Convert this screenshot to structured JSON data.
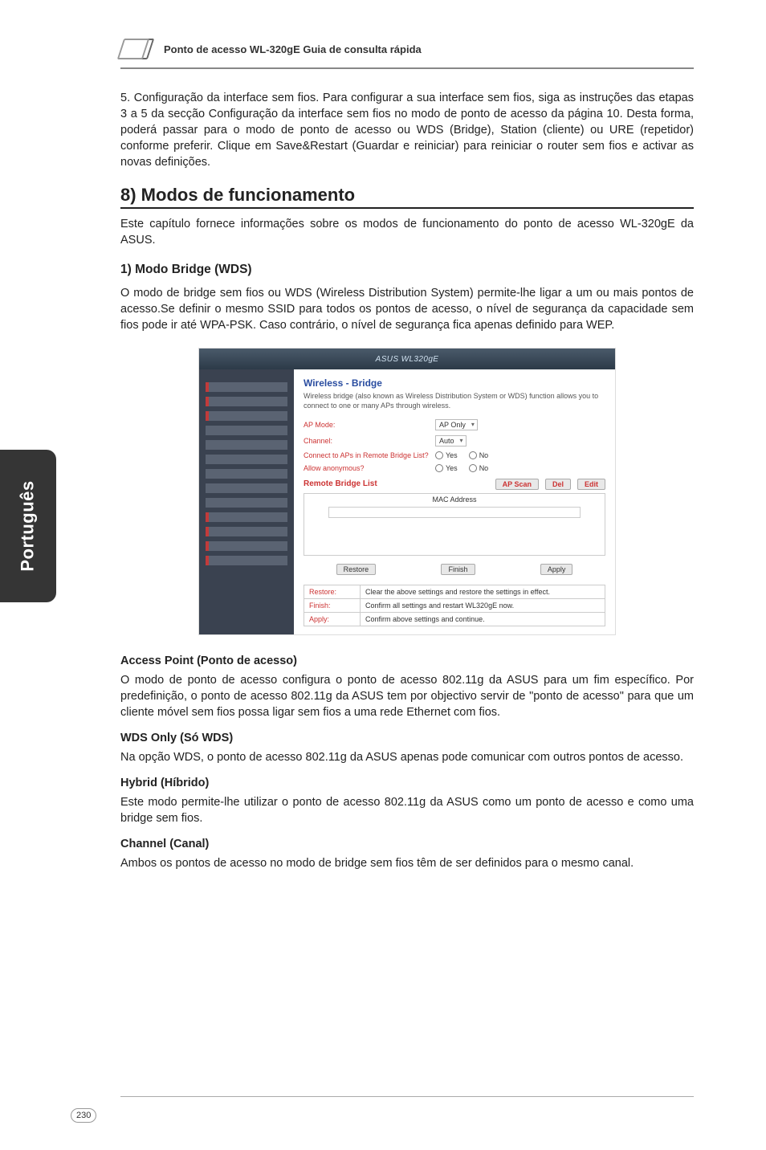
{
  "sideTab": "Português",
  "headerTitle": "Ponto de acesso WL-320gE Guia de consulta rápida",
  "para5": "5. Configuração da interface sem fios. Para configurar a sua interface sem fios, siga as instruções das etapas 3 a 5 da secção Configuração da interface sem fios no modo de ponto de acesso da página 10. Desta forma, poderá passar para o modo de ponto de acesso ou WDS (Bridge), Station (cliente) ou URE (repetidor) conforme preferir. Clique em Save&Restart (Guardar e reiniciar) para reiniciar o router sem fios e activar as novas definições.",
  "h1": "8) Modos de funcionamento",
  "introP": "Este capítulo fornece informações sobre os modos de funcionamento do ponto de acesso WL-320gE da ASUS.",
  "s1h2": "1) Modo Bridge (WDS)",
  "s1p": "O modo de bridge sem fios ou WDS (Wireless Distribution System) permite-lhe ligar a um ou mais pontos de acesso.Se definir o mesmo SSID para todos os pontos de acesso, o nível de segurança da capacidade sem fios pode ir até WPA-PSK. Caso contrário, o nível de segurança fica apenas definido para WEP.",
  "screenshot": {
    "titlebar": "ASUS WL320gE",
    "head": "Wireless - Bridge",
    "desc": "Wireless bridge (also known as Wireless Distribution System or WDS) function allows you to connect to one or many APs through wireless.",
    "labels": {
      "apmode": "AP Mode:",
      "channel": "Channel:",
      "connect": "Connect to APs in Remote Bridge List?",
      "anon": "Allow anonymous?",
      "remote": "Remote Bridge List"
    },
    "values": {
      "apmode": "AP Only",
      "channel": "Auto",
      "yes": "Yes",
      "no": "No"
    },
    "btns": {
      "apscan": "AP Scan",
      "del": "Del",
      "edit": "Edit",
      "restore": "Restore",
      "finish": "Finish",
      "apply": "Apply"
    },
    "macHead": "MAC Address",
    "tbl": {
      "restoreL": "Restore:",
      "restoreT": "Clear the above settings and restore the settings in effect.",
      "finishL": "Finish:",
      "finishT": "Confirm all settings and restart WL320gE now.",
      "applyL": "Apply:",
      "applyT": "Confirm above settings and continue."
    }
  },
  "apH": "Access Point (Ponto de acesso)",
  "apP": "O modo de ponto de acesso configura o ponto de acesso 802.11g da ASUS para um fim específico. Por predefinição, o ponto de acesso 802.11g da ASUS tem por objectivo servir de \"ponto de acesso\" para que um cliente móvel sem fios possa ligar sem fios a uma rede Ethernet com fios.",
  "wdsH": "WDS Only (Só WDS)",
  "wdsP": "Na opção WDS, o ponto de acesso 802.11g da ASUS apenas pode comunicar com outros pontos de acesso.",
  "hyH": "Hybrid (Híbrido)",
  "hyP": "Este modo permite-lhe utilizar o ponto de acesso 802.11g da ASUS como um ponto de acesso e como uma bridge sem fios.",
  "chH": "Channel (Canal)",
  "chP": "Ambos os pontos de acesso no modo de bridge sem fios têm de ser definidos para o mesmo canal.",
  "pageNum": "230"
}
